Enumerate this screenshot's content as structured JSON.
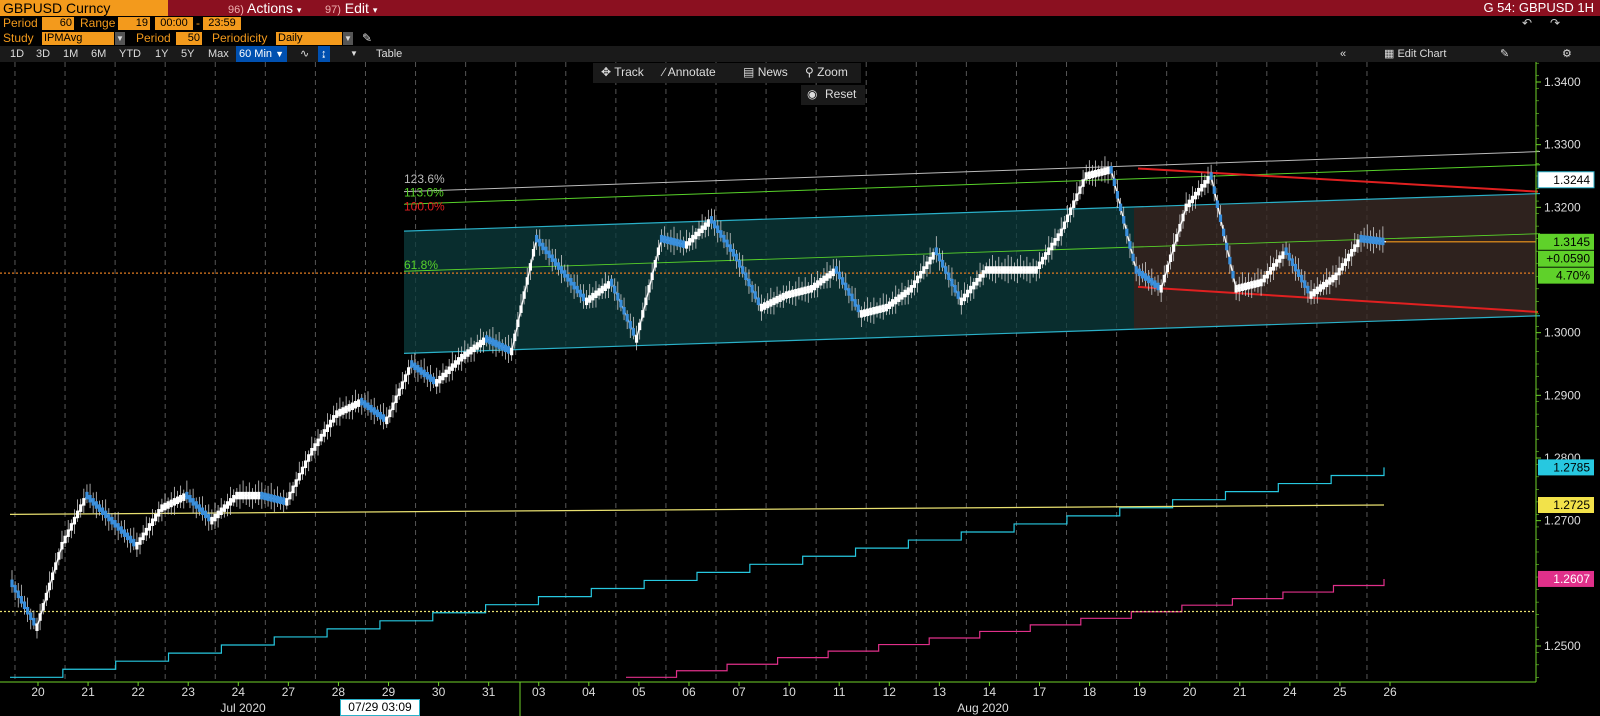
{
  "topbar": {
    "ticker": "GBPUSD Curncy",
    "actions_num": "96)",
    "actions_label": "Actions",
    "edit_num": "97)",
    "edit_label": "Edit",
    "security_title": "G 54: GBPUSD 1H"
  },
  "params": {
    "period_label": "Period",
    "period_value": "60",
    "range_label": "Range",
    "range_value": "19",
    "time_from": "00:00",
    "time_sep": "-",
    "time_to": "23:59"
  },
  "study": {
    "study_label": "Study",
    "study_value": "IPMAvg",
    "period_label": "Period",
    "period_value": "50",
    "periodicity_label": "Periodicity",
    "periodicity_value": "Daily"
  },
  "ranges": {
    "buttons": [
      "1D",
      "3D",
      "1M",
      "6M",
      "YTD",
      "1Y",
      "5Y",
      "Max"
    ],
    "selected": "60 Min",
    "table_label": "Table",
    "edit_chart_label": "Edit Chart"
  },
  "toolbar": {
    "track": "Track",
    "annotate": "Annotate",
    "news": "News",
    "zoom": "Zoom",
    "reset": "Reset"
  },
  "cursor_date": "07/29 03:09",
  "colors": {
    "bg": "#000000",
    "topbar": "#8b1020",
    "accent": "#f39a1c",
    "axis": "#6fd22a",
    "channel": "#2ab0c8",
    "fib_gray": "#bbbbbb",
    "fib_green": "#58d22a",
    "fib_red": "#e02020",
    "ma_cyan": "#27c8e0",
    "ma_yellow": "#e8e070",
    "ma_pink": "#e0308a"
  },
  "chart_data": {
    "type": "line",
    "title": "GBPUSD 1H",
    "ylim": [
      1.245,
      1.345
    ],
    "yticks": [
      "1.3400",
      "1.3300",
      "1.3200",
      "1.3000",
      "1.2900",
      "1.2800",
      "1.2700",
      "1.2500"
    ],
    "x_ticks": [
      "20",
      "21",
      "22",
      "23",
      "24",
      "27",
      "28",
      "29",
      "30",
      "31",
      "03",
      "04",
      "05",
      "06",
      "07",
      "10",
      "11",
      "12",
      "13",
      "14",
      "17",
      "18",
      "19",
      "20",
      "21",
      "24",
      "25",
      "26"
    ],
    "month_labels": [
      "Jul 2020",
      "Aug 2020"
    ],
    "grid": true,
    "fib_labels": [
      {
        "text": "123.6%",
        "color": "#bbbbbb"
      },
      {
        "text": "113.0%",
        "color": "#58d22a"
      },
      {
        "text": "100.0%",
        "color": "#e02020"
      },
      {
        "text": "61.8%",
        "color": "#58d22a"
      }
    ],
    "price_tags": [
      {
        "label": "1.3244",
        "value": 1.3244,
        "bg": "#ffffff",
        "fg": "#000000",
        "border": "#2ab0c8"
      },
      {
        "label": "1.3145",
        "value": 1.3145,
        "bg": "#5fd12a",
        "fg": "#000000"
      },
      {
        "label": "+0.0590",
        "value": 1.3118,
        "bg": "#5fd12a",
        "fg": "#000000"
      },
      {
        "label": "4.70%",
        "value": 1.3091,
        "bg": "#5fd12a",
        "fg": "#000000"
      },
      {
        "label": "1.2785",
        "value": 1.2785,
        "bg": "#27c8e0",
        "fg": "#000000"
      },
      {
        "label": "1.2725",
        "value": 1.2725,
        "bg": "#f2e24a",
        "fg": "#000000"
      },
      {
        "label": "1.2607",
        "value": 1.2607,
        "bg": "#e0308a",
        "fg": "#ffffff"
      }
    ],
    "series": [
      {
        "name": "GBPUSD",
        "color": "#ffffff",
        "values": [
          1.26,
          1.253,
          1.266,
          1.274,
          1.27,
          1.266,
          1.272,
          1.274,
          1.27,
          1.274,
          1.274,
          1.273,
          1.281,
          1.287,
          1.289,
          1.286,
          1.295,
          1.292,
          1.296,
          1.299,
          1.297,
          1.315,
          1.31,
          1.305,
          1.308,
          1.299,
          1.315,
          1.314,
          1.318,
          1.312,
          1.304,
          1.306,
          1.307,
          1.31,
          1.303,
          1.304,
          1.307,
          1.313,
          1.305,
          1.31,
          1.31,
          1.31,
          1.316,
          1.325,
          1.326,
          1.31,
          1.307,
          1.32,
          1.325,
          1.307,
          1.308,
          1.313,
          1.306,
          1.309,
          1.315,
          1.3145
        ]
      }
    ],
    "moving_averages": [
      {
        "color": "#27c8e0",
        "start": 1.245,
        "end": 1.2785,
        "last": 1.2785
      },
      {
        "color": "#e8e070",
        "start": 1.271,
        "end": 1.2725,
        "last": 1.2725
      },
      {
        "color": "#e0308a",
        "start": 1.245,
        "end": 1.2607,
        "last": 1.2607
      }
    ],
    "horizontal_refs": [
      {
        "value": 1.3095,
        "color": "#e07a20",
        "style": "dotted"
      },
      {
        "value": 1.2555,
        "color": "#e8e070",
        "style": "dotted"
      },
      {
        "value": 1.3145,
        "color": "#f39a1c",
        "style": "solid"
      }
    ]
  }
}
